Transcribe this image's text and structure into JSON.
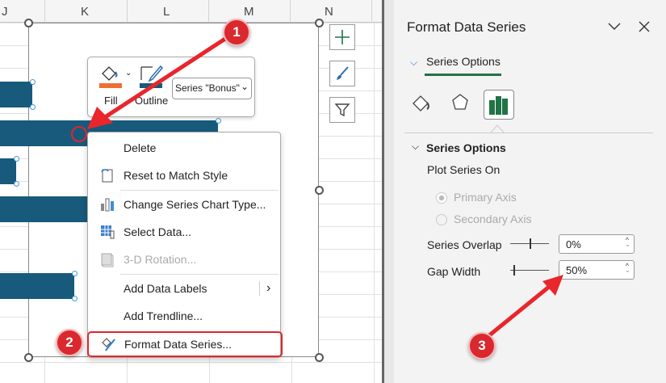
{
  "sheet": {
    "columns": [
      "J",
      "K",
      "L",
      "M",
      "N"
    ]
  },
  "mini_toolbar": {
    "fill_label": "Fill",
    "outline_label": "Outline",
    "series_select": "Series \"Bonus\""
  },
  "context_menu": {
    "items": [
      {
        "label": "Delete",
        "icon": "none"
      },
      {
        "label": "Reset to Match Style",
        "icon": "reset-style-icon"
      },
      {
        "label": "Change Series Chart Type...",
        "icon": "chart-type-icon"
      },
      {
        "label": "Select Data...",
        "icon": "select-data-icon"
      },
      {
        "label": "3-D Rotation...",
        "icon": "rotation-3d-icon",
        "disabled": true
      },
      {
        "label": "Add Data Labels",
        "icon": "none",
        "submenu": true
      },
      {
        "label": "Add Trendline...",
        "icon": "none"
      },
      {
        "label": "Format Data Series...",
        "icon": "format-series-icon",
        "highlighted": true
      }
    ]
  },
  "panel": {
    "title": "Format Data Series",
    "tab": "Series Options",
    "section": "Series Options",
    "plot_on_label": "Plot Series On",
    "primary_axis": "Primary Axis",
    "secondary_axis": "Secondary Axis",
    "overlap_label": "Series Overlap",
    "overlap_value": "0%",
    "gap_label": "Gap Width",
    "gap_value": "50%"
  },
  "annotations": [
    "1",
    "2",
    "3"
  ],
  "colors": {
    "bar": "#175a7c",
    "accent": "#217346",
    "callout": "#d9292f"
  }
}
